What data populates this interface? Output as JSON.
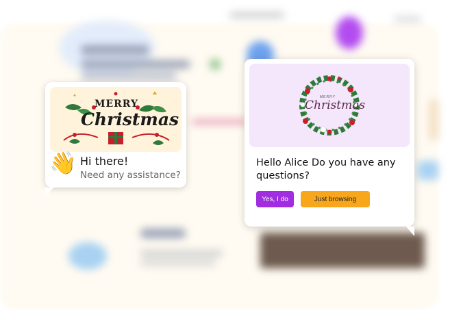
{
  "widget_small": {
    "banner_line1": "MERRY",
    "banner_line2": "Christmas",
    "wave_icon": "waving-hand-icon",
    "title": "Hi there!",
    "subtitle": "Need any assistance?"
  },
  "widget_main": {
    "banner_small_text": "MERRY",
    "banner_script": "Christmas",
    "question": "Hello Alice Do you have any questions?",
    "buttons": {
      "yes": "Yes, I do",
      "browse": "Just browsing"
    }
  },
  "colors": {
    "accent_purple": "#a02ee0",
    "accent_orange": "#f8a61c",
    "holly_green": "#2f7a3a",
    "berry_red": "#c8202a"
  }
}
